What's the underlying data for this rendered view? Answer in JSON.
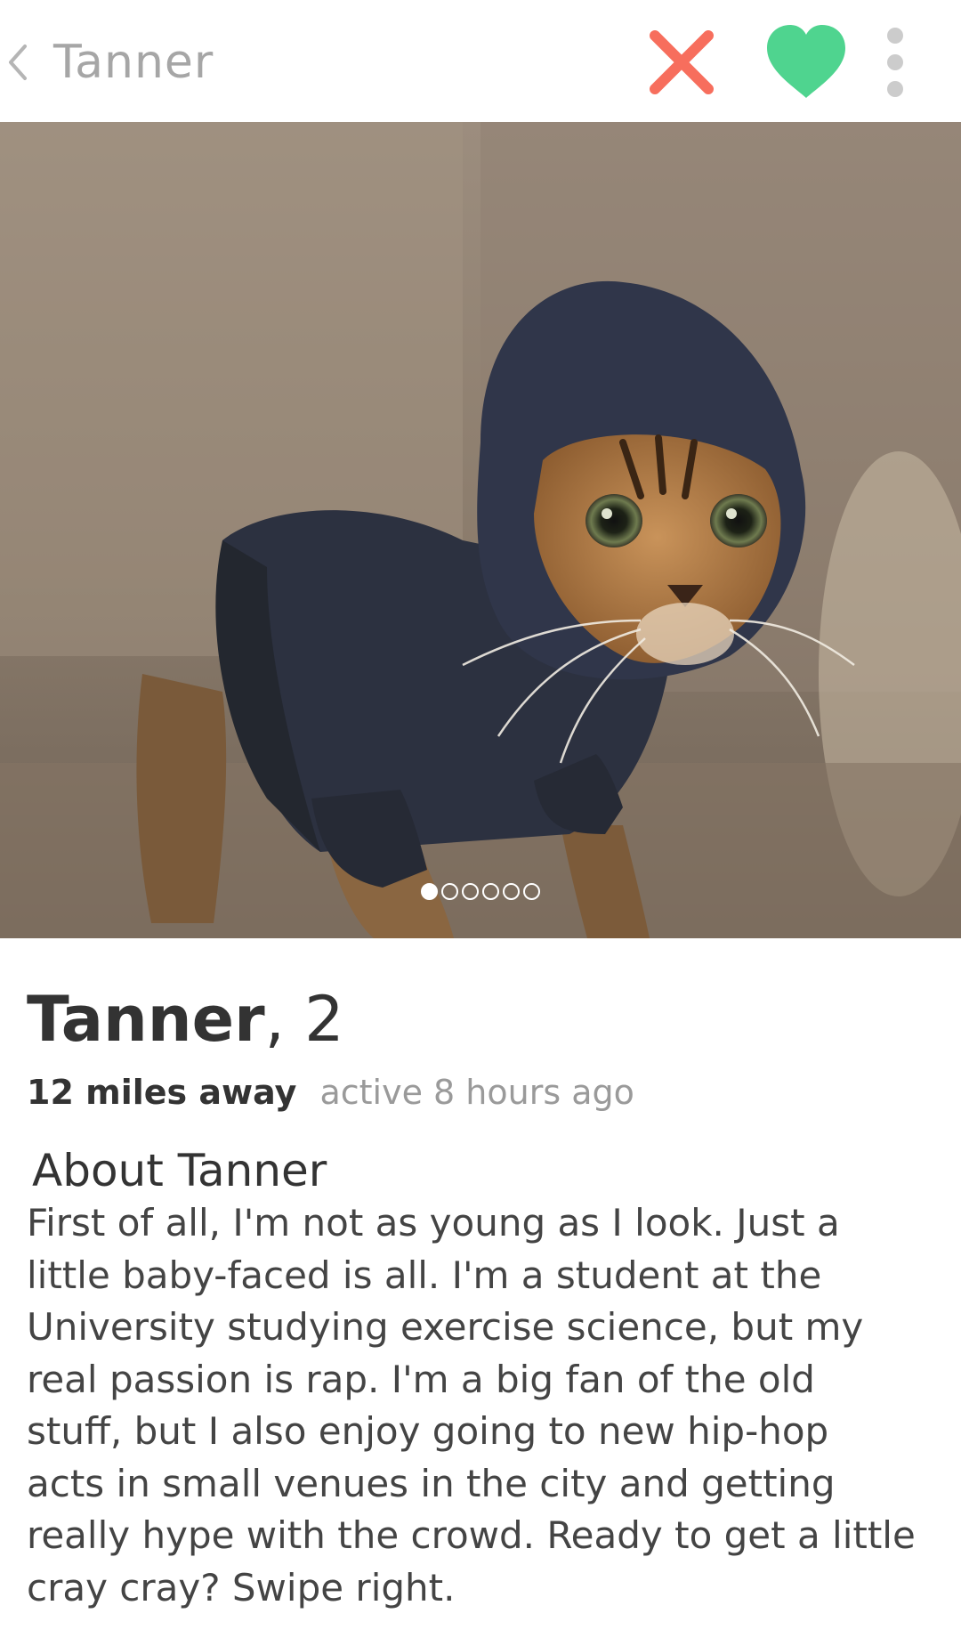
{
  "header": {
    "back_icon": "chevron-left-icon",
    "title": "Tanner",
    "dislike_icon": "close-x-icon",
    "like_icon": "heart-icon",
    "more_icon": "more-vertical-icon",
    "colors": {
      "dislike": "#f76e5d",
      "like": "#4fd48f",
      "more": "#cccccc",
      "title": "#a6a6a6"
    }
  },
  "photo": {
    "indicator": {
      "count": 6,
      "active_index": 0
    }
  },
  "profile": {
    "name": "Tanner",
    "age_text": ", 2",
    "distance": "12 miles away",
    "activity": "active 8 hours ago"
  },
  "about": {
    "heading": "About Tanner",
    "bio": "First of all, I'm not as young as I look. Just a little baby-faced is all. I'm a student at the University studying exercise science, but my real passion is rap. I'm a big fan of the old stuff, but I also enjoy going to new hip-hop acts in small venues in the city and getting really hype with the crowd. Ready to get a little cray cray? Swipe right."
  }
}
